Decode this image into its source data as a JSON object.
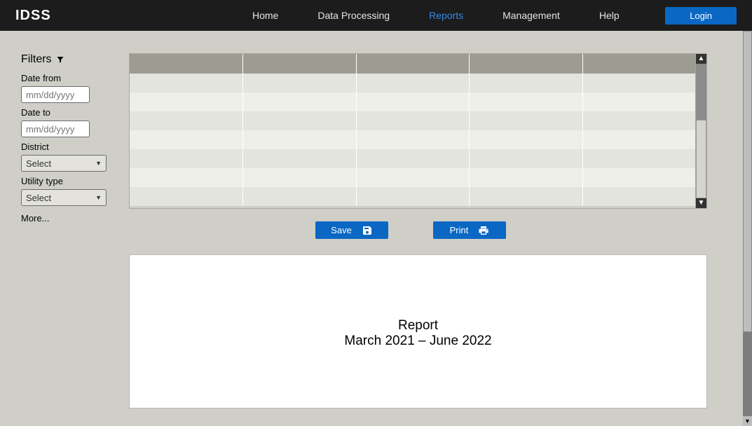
{
  "brand": "IDSS",
  "nav": {
    "home": "Home",
    "data_processing": "Data Processing",
    "reports": "Reports",
    "management": "Management",
    "help": "Help"
  },
  "login_label": "Login",
  "sidebar": {
    "title": "Filters",
    "date_from_label": "Date from",
    "date_from_placeholder": "mm/dd/yyyy",
    "date_to_label": "Date to",
    "date_to_placeholder": "mm/dd/yyyy",
    "district_label": "District",
    "district_value": "Select",
    "utility_label": "Utility type",
    "utility_value": "Select",
    "more": "More..."
  },
  "actions": {
    "save": "Save",
    "print": "Print"
  },
  "report": {
    "title": "Report",
    "range": "March 2021 – June 2022"
  }
}
